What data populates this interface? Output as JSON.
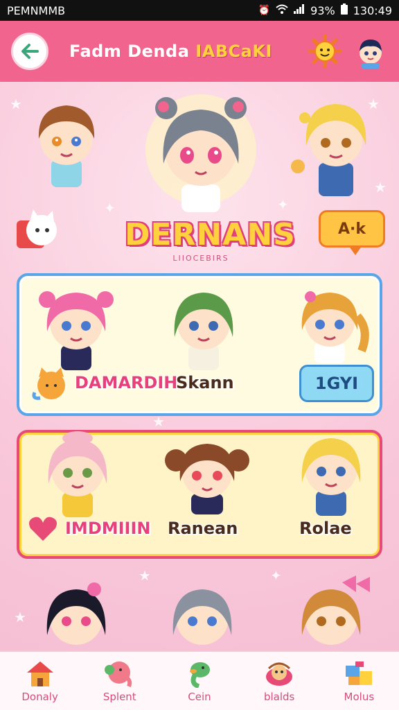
{
  "status_bar": {
    "carrier": "PEMNMMB",
    "battery": "93%",
    "time": "130:49"
  },
  "header": {
    "title": "Fadm Denda",
    "title_accent": "IABCaKI",
    "back_icon": "arrow-left-icon",
    "sun_icon": "sun-face-icon",
    "avatar_icon": "avatar-boy-icon"
  },
  "hero": {
    "title": "DERNANS",
    "subtitle": "LIIOCEBIRS",
    "bubble_label": "A·k"
  },
  "panel_1": {
    "names": [
      "DAMARDIH",
      "Skann"
    ],
    "level_label": "1GYI"
  },
  "panel_2": {
    "names": [
      "IMDMIIIN",
      "Ranean",
      "Rolae"
    ]
  },
  "nav": {
    "items": [
      {
        "label": "Donaly",
        "icon": "home-icon"
      },
      {
        "label": "Splent",
        "icon": "elephant-icon"
      },
      {
        "label": "Cein",
        "icon": "dino-icon"
      },
      {
        "label": "blalds",
        "icon": "basket-icon"
      },
      {
        "label": "Molus",
        "icon": "blocks-icon"
      }
    ]
  },
  "colors": {
    "header": "#f0648e",
    "background": "#f9c4d8",
    "accent_yellow": "#ffd23d",
    "panel_blue": "#5aa5e8",
    "panel_pink": "#e84a78"
  }
}
